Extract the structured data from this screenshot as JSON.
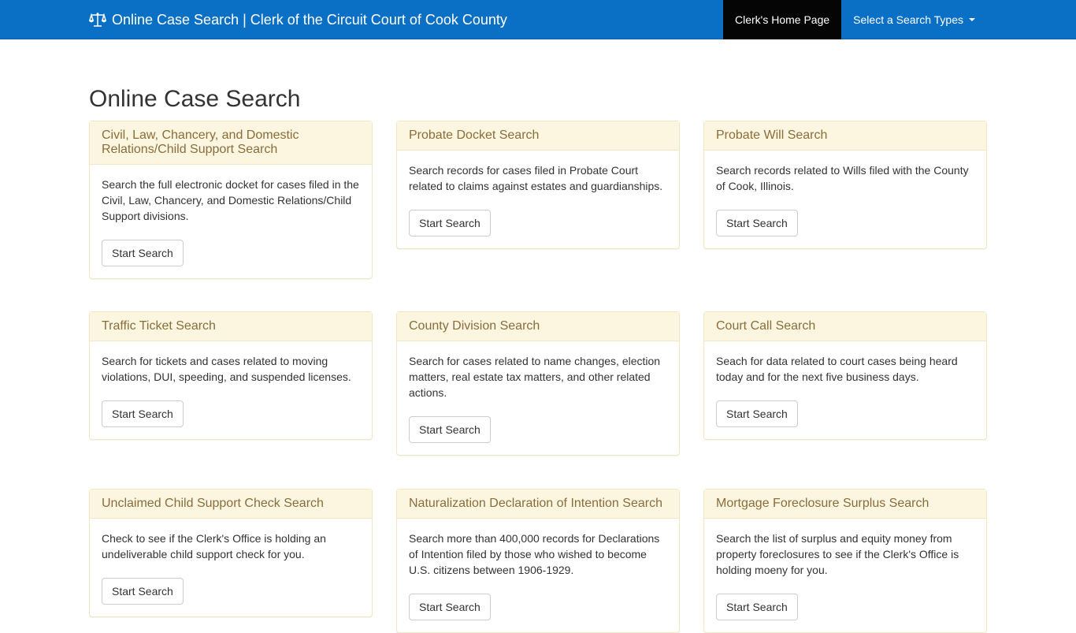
{
  "navbar": {
    "brand": "Online Case Search | Clerk of the Circuit Court of Cook County",
    "home_link": "Clerk's Home Page",
    "search_types": "Select a Search Types",
    "bg_color": "#0a70c6"
  },
  "page": {
    "title": "Online Case Search"
  },
  "cards": [
    {
      "title": "Civil, Law, Chancery, and Domestic Relations/Child Support Search",
      "desc": "Search the full electronic docket for cases filed in the Civil, Law, Chancery, and Domestic Relations/Child Support divisions.",
      "button": "Start Search"
    },
    {
      "title": "Probate Docket Search",
      "desc": "Search records for cases filed in Probate Court related to claims against estates and guardianships.",
      "button": "Start Search"
    },
    {
      "title": "Probate Will Search",
      "desc": "Search records related to Wills filed with the County of Cook, Illinois.",
      "button": "Start Search"
    },
    {
      "title": "Traffic Ticket Search",
      "desc": "Search for tickets and cases related to moving violations, DUI, speeding, and suspended licenses.",
      "button": "Start Search"
    },
    {
      "title": "County Division Search",
      "desc": "Search for cases related to name changes, election matters, real estate tax matters, and other related actions.",
      "button": "Start Search"
    },
    {
      "title": "Court Call Search",
      "desc": "Seach for data related to court cases being heard today and for the next five business days.",
      "button": "Start Search"
    },
    {
      "title": "Unclaimed Child Support Check Search",
      "desc": "Check to see if the Clerk's Office is holding an undeliverable child support check for you.",
      "button": "Start Search"
    },
    {
      "title": "Naturalization Declaration of Intention Search",
      "desc": "Search more than 400,000 records for Declarations of Intention filed by those who wished to become U.S. citizens between 1906-1929.",
      "button": "Start Search"
    },
    {
      "title": "Mortgage Foreclosure Surplus Search",
      "desc": "Search the list of surplus and equity money from property foreclosures to see if the Clerk's Office is holding moeny for you.",
      "button": "Start Search"
    }
  ]
}
